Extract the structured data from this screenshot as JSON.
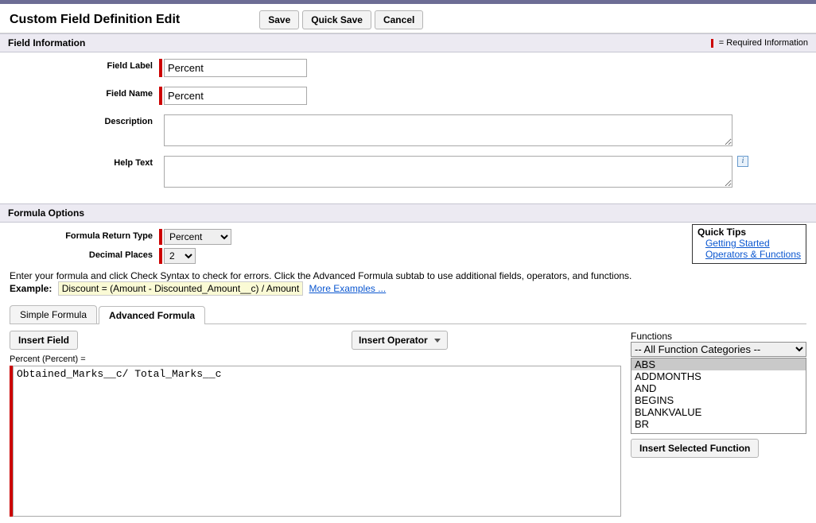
{
  "header": {
    "title": "Custom Field Definition Edit",
    "save": "Save",
    "quick_save": "Quick Save",
    "cancel": "Cancel"
  },
  "field_info": {
    "title": "Field Information",
    "required_hint": " = Required Information",
    "labels": {
      "field_label": "Field Label",
      "field_name": "Field Name",
      "description": "Description",
      "help_text": "Help Text"
    },
    "values": {
      "field_label": "Percent",
      "field_name": "Percent",
      "description": "",
      "help_text": ""
    }
  },
  "formula_options": {
    "title": "Formula Options",
    "labels": {
      "return_type": "Formula Return Type",
      "decimal_places": "Decimal Places"
    },
    "return_type_value": "Percent",
    "decimal_places_value": "2",
    "intro": "Enter your formula and click Check Syntax to check for errors. Click the Advanced Formula subtab to use additional fields, operators, and functions.",
    "example_label": "Example:",
    "example_code": "Discount = (Amount - Discounted_Amount__c) / Amount",
    "more_examples": "More Examples ..."
  },
  "quick_tips": {
    "title": "Quick Tips",
    "links": [
      "Getting Started",
      "Operators & Functions"
    ]
  },
  "tabs": {
    "simple": "Simple Formula",
    "advanced": "Advanced Formula"
  },
  "editor": {
    "insert_field": "Insert Field",
    "insert_operator": "Insert Operator",
    "formula_label": "Percent (Percent) =",
    "formula_value": "Obtained_Marks__c/ Total_Marks__c"
  },
  "functions": {
    "label": "Functions",
    "category": "-- All Function Categories --",
    "list": [
      "ABS",
      "ADDMONTHS",
      "AND",
      "BEGINS",
      "BLANKVALUE",
      "BR"
    ],
    "insert_selected": "Insert Selected Function"
  }
}
